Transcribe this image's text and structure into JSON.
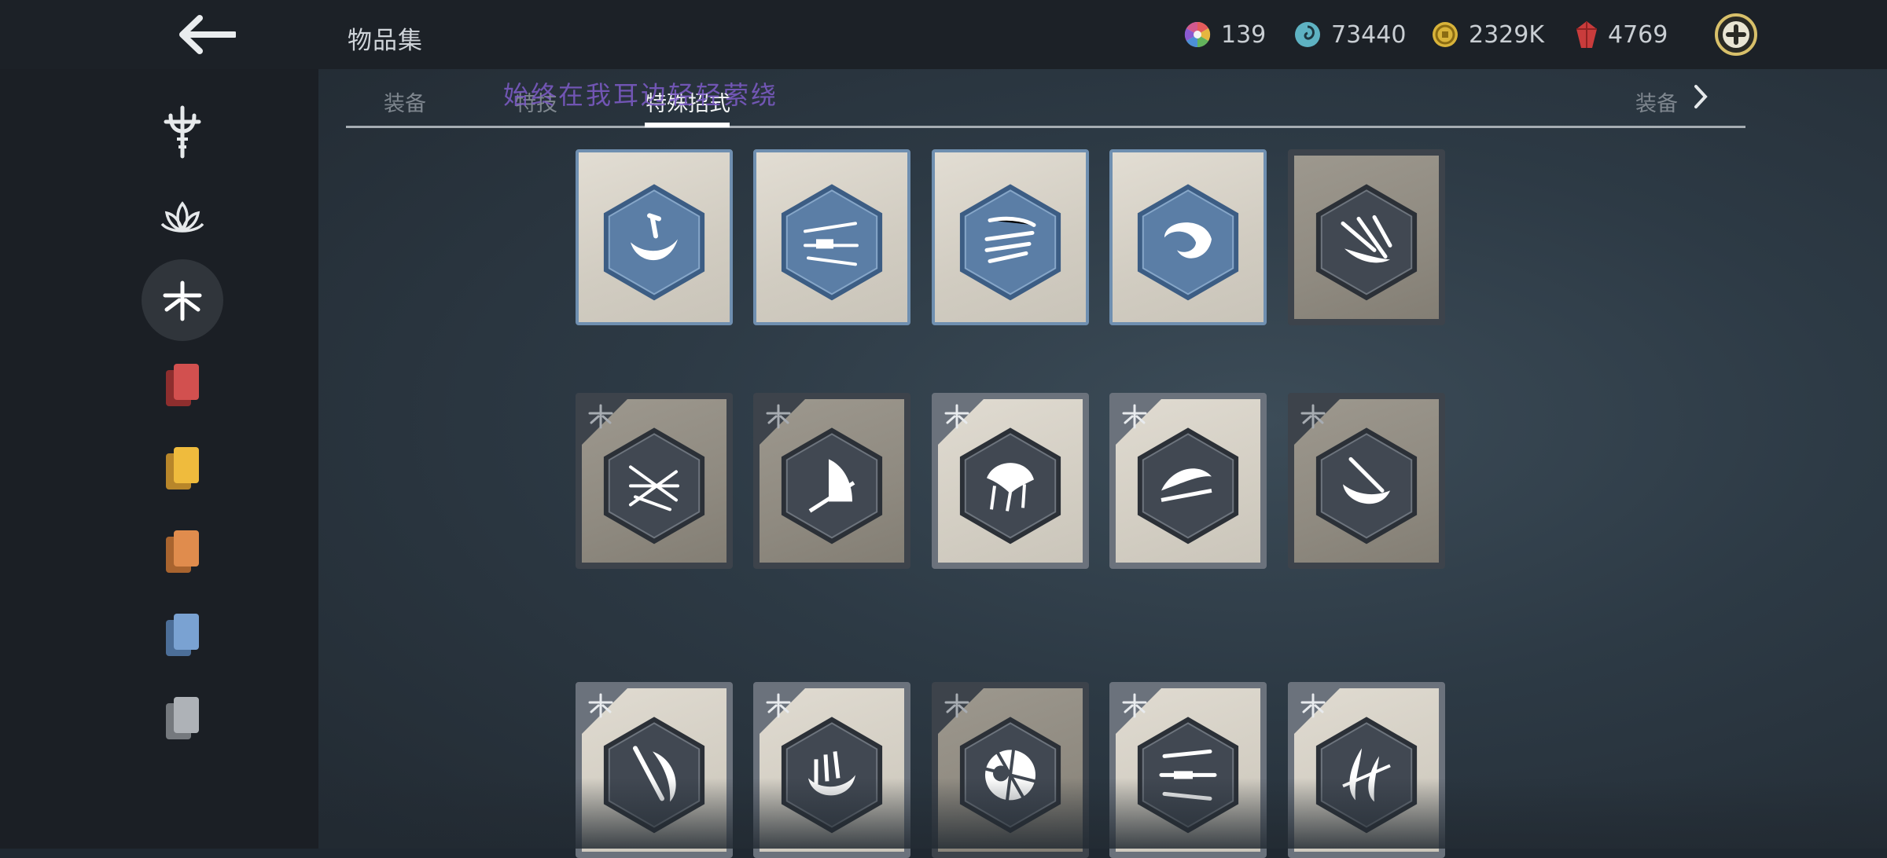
{
  "header": {
    "title": "物品集",
    "currencies": [
      {
        "name": "rainbow-orb",
        "value": "139"
      },
      {
        "name": "spiral-token",
        "value": "73440"
      },
      {
        "name": "gold-coin",
        "value": "2329K"
      },
      {
        "name": "red-gem",
        "value": "4769"
      }
    ]
  },
  "sidebar": {
    "items": [
      {
        "name": "weapons-category",
        "icon": "trident-emblem-icon"
      },
      {
        "name": "lotus-category",
        "icon": "lotus-icon"
      },
      {
        "name": "dragonfly-category",
        "icon": "dragonfly-icon",
        "active": true
      },
      {
        "name": "red-cards",
        "icon": "card-stack-icon",
        "color": "#c94a4a"
      },
      {
        "name": "yellow-cards",
        "icon": "card-stack-icon",
        "color": "#e8b13a"
      },
      {
        "name": "orange-cards",
        "icon": "card-stack-icon",
        "color": "#d98a4a"
      },
      {
        "name": "blue-cards",
        "icon": "card-stack-icon",
        "color": "#6c95c6"
      },
      {
        "name": "grey-cards",
        "icon": "card-stack-icon",
        "color": "#a5a9ae"
      }
    ]
  },
  "tabs": {
    "left": "装备",
    "second": "特技",
    "active": "特殊招式",
    "right": "装备"
  },
  "overlay_text": "始终在我耳边轻轻萦绕",
  "cards": [
    {
      "style": "blue",
      "icon": "crescent-blade-icon"
    },
    {
      "style": "blue",
      "icon": "arrow-slash-icon"
    },
    {
      "style": "blue",
      "icon": "wind-blades-icon"
    },
    {
      "style": "blue",
      "icon": "spin-claw-icon"
    },
    {
      "style": "dark",
      "icon": "dagger-burst-icon"
    },
    {
      "style": "dark",
      "icon": "triple-spear-icon",
      "marked": true
    },
    {
      "style": "dark",
      "icon": "sail-blade-icon",
      "marked": true
    },
    {
      "style": "light",
      "icon": "umbrella-strike-icon",
      "marked": true
    },
    {
      "style": "light",
      "icon": "sweeping-slash-icon",
      "marked": true
    },
    {
      "style": "dark",
      "icon": "moon-axe-icon",
      "marked": true
    },
    {
      "style": "light",
      "icon": "cleave-icon",
      "marked": true
    },
    {
      "style": "light",
      "icon": "whirl-crescent-icon",
      "marked": true
    },
    {
      "style": "dark",
      "icon": "wheel-strike-icon",
      "marked": true
    },
    {
      "style": "light",
      "icon": "piercing-thrust-icon",
      "marked": true
    },
    {
      "style": "light",
      "icon": "twin-hook-icon",
      "marked": true
    }
  ],
  "colors": {
    "accent_blue": "#5b7ea6",
    "hex_dark": "#414852",
    "overlay_purple": "#7e5cc9",
    "add_gold": "#d8c06a"
  }
}
